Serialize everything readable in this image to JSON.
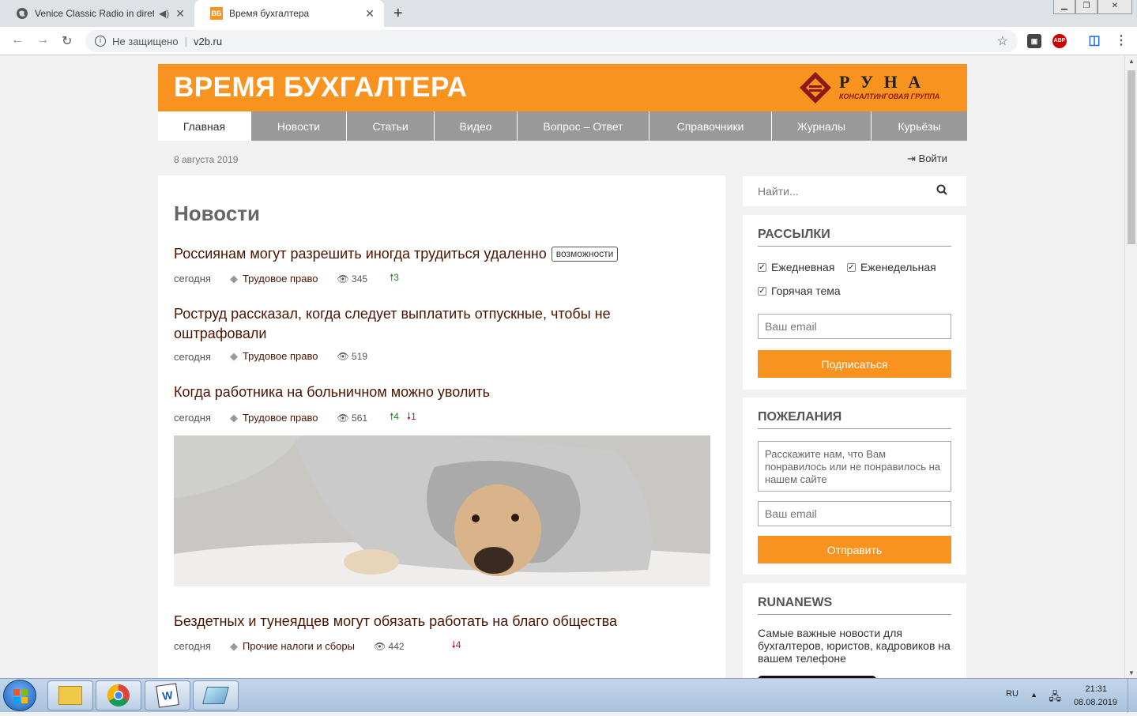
{
  "browser": {
    "tabs": [
      {
        "title": "Venice Classic Radio in dirett",
        "active": false
      },
      {
        "title": "Время бухгалтера",
        "active": true,
        "favicon_text": "ВБ"
      }
    ],
    "address": {
      "security": "Не защищено",
      "url": "v2b.ru"
    },
    "extensions": {
      "abp": "ABP"
    }
  },
  "site": {
    "title": "ВРЕМЯ БУХГАЛТЕРА",
    "partner": {
      "name": "Р У Н А",
      "subtitle": "КОНСАЛТИНГОВАЯ ГРУППА"
    },
    "nav": [
      "Главная",
      "Новости",
      "Статьи",
      "Видео",
      "Вопрос – Ответ",
      "Справочники",
      "Журналы",
      "Курьёзы"
    ],
    "active_nav": 0,
    "date": "8 августа 2019",
    "login": "Войти",
    "accent_color": "#f7931e"
  },
  "main": {
    "heading": "Новости",
    "news": [
      {
        "title": "Россиянам могут разрешить иногда трудиться удаленно",
        "badge": "возможности",
        "when": "сегодня",
        "category": "Трудовое право",
        "views": "345",
        "up": "3",
        "down": ""
      },
      {
        "title": "Роструд рассказал, когда следует выплатить отпускные, чтобы не оштрафовали",
        "badge": "",
        "when": "сегодня",
        "category": "Трудовое право",
        "views": "519",
        "up": "",
        "down": ""
      },
      {
        "title": "Когда работника на больничном можно уволить",
        "badge": "",
        "when": "сегодня",
        "category": "Трудовое право",
        "views": "561",
        "up": "4",
        "down": "1"
      },
      {
        "title": "Бездетных и тунеядцев могут обязать работать на благо общества",
        "badge": "",
        "when": "сегодня",
        "category": "Прочие налоги и сборы",
        "views": "442",
        "up": "",
        "down": "4"
      }
    ]
  },
  "sidebar": {
    "search_placeholder": "Найти...",
    "subscriptions": {
      "title": "РАССЫЛКИ",
      "options": [
        {
          "label": "Ежедневная",
          "checked": true
        },
        {
          "label": "Еженедельная",
          "checked": true
        },
        {
          "label": "Горячая тема",
          "checked": true
        }
      ],
      "email_placeholder": "Ваш email",
      "button": "Подписаться"
    },
    "wishes": {
      "title": "ПОЖЕЛАНИЯ",
      "textarea_placeholder": "Расскажите нам, что Вам понравилось или не понравилось на нашем сайте",
      "email_placeholder": "Ваш email",
      "button": "Отправить"
    },
    "runanews": {
      "title": "RUNANEWS",
      "text": "Самые важные новости для бухгалтеров, юристов, кадровиков на вашем телефоне"
    }
  },
  "taskbar": {
    "lang": "RU",
    "time": "21:31",
    "date": "08.08.2019"
  }
}
